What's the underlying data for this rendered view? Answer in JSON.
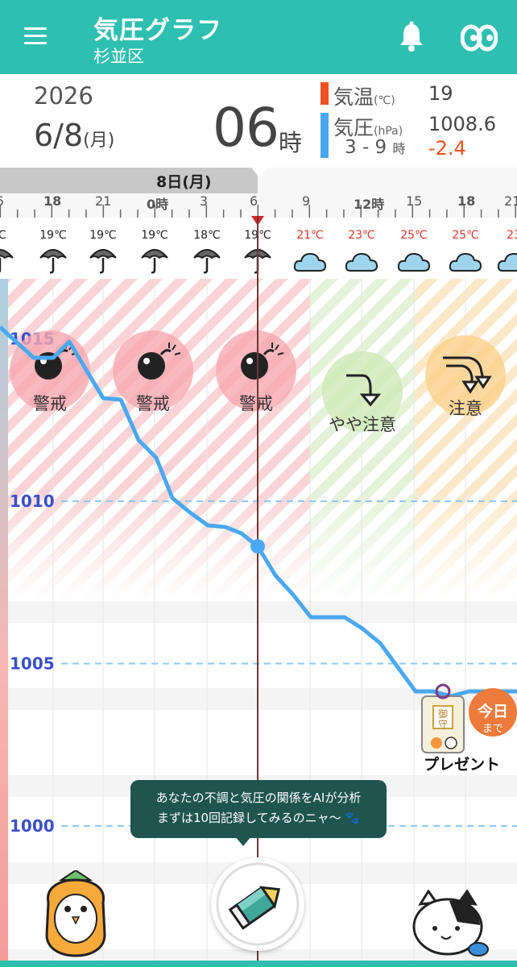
{
  "header": {
    "title": "気圧グラフ",
    "location": "杉並区",
    "menu_icon": "hamburger-menu-icon",
    "bell_icon": "bell-icon",
    "logo_icon": "app-logo-icon",
    "color": "#2ebfb0"
  },
  "info": {
    "year": "2026",
    "date": "6/8",
    "weekday": "(月)",
    "hour": "06",
    "hour_suffix": "時",
    "temp_label": "気温",
    "temp_unit": "(℃)",
    "temp_value": "19",
    "pressure_label": "気圧",
    "pressure_unit": "(hPa)",
    "pressure_value": "1008.6",
    "range_text": "3 - 9",
    "range_suffix": "時",
    "change_value": "-2.4",
    "temp_color": "#f0501e",
    "pressure_color": "#4aa8f0",
    "change_color": "#f0501e"
  },
  "timeline": {
    "day_label": "8日(月)",
    "ticks": [
      "5",
      "18",
      "21",
      "0時",
      "3",
      "6",
      "9",
      "12時",
      "15",
      "18",
      "21"
    ]
  },
  "weather": {
    "temps": [
      "℃",
      "19℃",
      "19℃",
      "19℃",
      "18℃",
      "19℃",
      "21℃",
      "23℃",
      "25℃",
      "25℃",
      "23"
    ],
    "icons": [
      "umbrella-icon",
      "umbrella-icon",
      "umbrella-icon",
      "umbrella-icon",
      "umbrella-icon",
      "umbrella-icon",
      "cloud-icon",
      "cloud-icon",
      "cloud-icon",
      "cloud-icon",
      "cloud-icon"
    ]
  },
  "graph": {
    "y_labels": [
      "1015",
      "1010",
      "1005",
      "1000"
    ],
    "risks": [
      {
        "icon": "bomb-icon",
        "label": "警戒"
      },
      {
        "icon": "bomb-icon",
        "label": "警戒"
      },
      {
        "icon": "bomb-icon",
        "label": "警戒"
      },
      {
        "icon": "arrow-down-icon",
        "label": "やや注意"
      },
      {
        "icon": "double-arrow-down-icon",
        "label": "注意"
      }
    ],
    "pressure_series_hPa": [
      1015.4,
      1014.4,
      1014.8,
      1013.3,
      1013.2,
      1011.8,
      1010.1,
      1009.3,
      1008.6,
      1007.2,
      1006.4,
      1006.4,
      1005.4,
      1004.0,
      1004.0,
      1004.0
    ],
    "current_pressure": 1008.6,
    "warning_color": "#f5a0a8",
    "caution_color": "#f8c878",
    "light_caution_color": "#c8e6b0",
    "line_color": "#4aa8f0"
  },
  "tooltip": {
    "line1": "あなたの不調と気圧の関係をAIが分析",
    "line2": "まずは10回記録してみるのニャ〜"
  },
  "present": {
    "label": "プレゼント",
    "badge_line1": "今日",
    "badge_line2": "まで",
    "charm_text": "御守"
  },
  "record_button_icon": "pencil-icon",
  "mascots": [
    "owl-mascot-icon",
    "cat-mascot-icon"
  ]
}
